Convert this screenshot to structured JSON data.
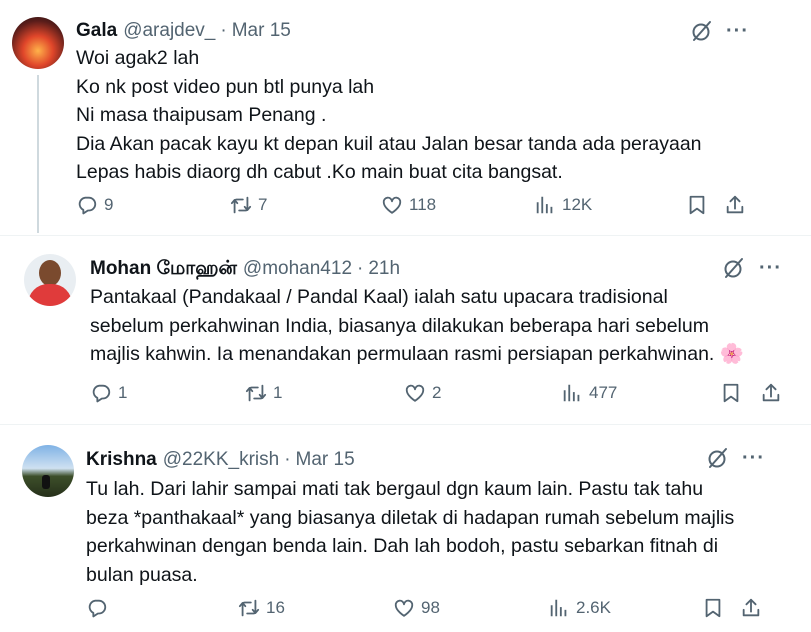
{
  "tweets": [
    {
      "name": "Gala",
      "handle": "@arajdev_",
      "separator": "·",
      "time": "Mar 15",
      "text": "Woi agak2 lah\nKo nk post video pun btl punya lah\nNi masa thaipusam Penang .\nDia Akan pacak kayu kt depan kuil atau Jalan besar tanda ada perayaan\nLepas habis diaorg dh cabut .Ko main buat cita bangsat.",
      "replies": "9",
      "reposts": "7",
      "likes": "118",
      "views": "12K"
    },
    {
      "name": "Mohan மோஹன்",
      "handle": "@mohan412",
      "separator": "·",
      "time": "21h",
      "text": "Pantakaal (Pandakaal / Pandal Kaal) ialah satu upacara tradisional\nsebelum perkahwinan India, biasanya dilakukan beberapa hari sebelum\nmajlis kahwin. Ia menandakan permulaan rasmi persiapan perkahwinan. 🌸",
      "replies": "1",
      "reposts": "1",
      "likes": "2",
      "views": "477"
    },
    {
      "name": "Krishna",
      "handle": "@22KK_krish",
      "separator": "·",
      "time": "Mar 15",
      "text": "Tu lah. Dari lahir sampai mati tak bergaul dgn kaum lain. Pastu tak tahu\nbeza *panthakaal* yang biasanya diletak di hadapan rumah sebelum majlis\nperkahwinan dengan benda lain. Dah lah bodoh, pastu sebarkan fitnah di\nbulan puasa.",
      "replies": "",
      "reposts": "16",
      "likes": "98",
      "views": "2.6K"
    }
  ],
  "icons": {
    "more": "more-icon",
    "grok": "grok-icon",
    "reply": "reply-icon",
    "repost": "repost-icon",
    "like": "like-icon",
    "views": "views-icon",
    "bookmark": "bookmark-icon",
    "share": "share-icon"
  },
  "colors": {
    "text": "#0f1419",
    "secondary": "#536471",
    "divider": "#eff3f4"
  }
}
